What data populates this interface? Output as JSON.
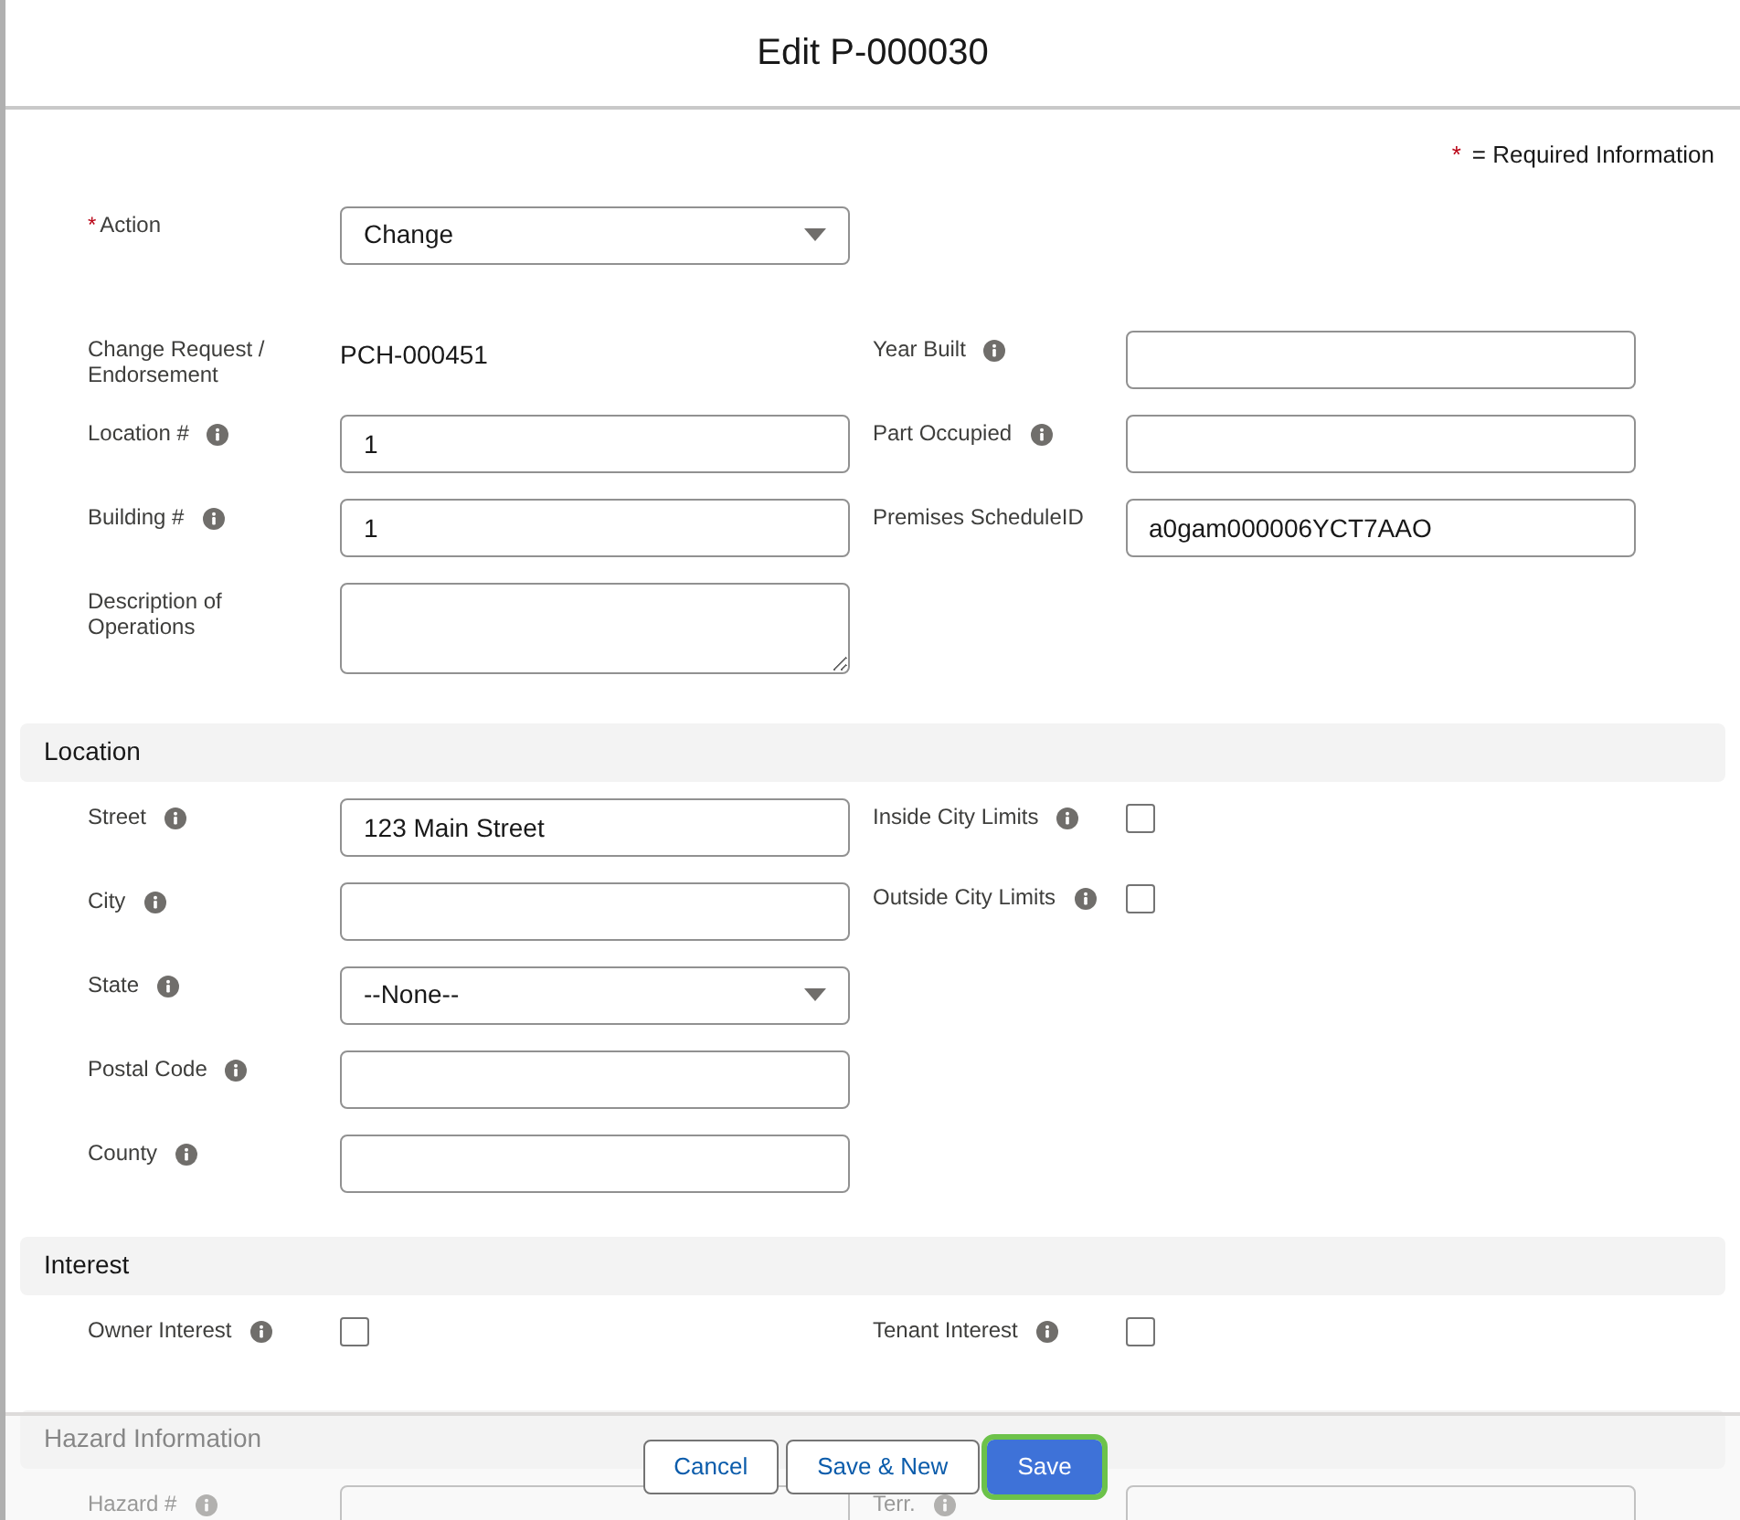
{
  "modal": {
    "title": "Edit P-000030"
  },
  "required_legend": {
    "mark": "*",
    "text": "= Required Information"
  },
  "top_field": {
    "label": "Action",
    "required": true,
    "kind": "select",
    "value": "Change",
    "info": false
  },
  "main_fields": {
    "left": [
      {
        "label": "Change Request / Endorsement",
        "kind": "static",
        "value": "PCH-000451",
        "info": false
      },
      {
        "label": "Location #",
        "kind": "text",
        "value": "1",
        "info": true
      },
      {
        "label": "Building #",
        "kind": "text",
        "value": "1",
        "info": true
      },
      {
        "label": "Description of Operations",
        "kind": "textarea",
        "info": false
      }
    ],
    "right": [
      {
        "label": "Year Built",
        "kind": "text",
        "info": true
      },
      {
        "label": "Part Occupied",
        "kind": "text",
        "info": true
      },
      {
        "label": "Premises ScheduleID",
        "kind": "text",
        "value": "a0gam000006YCT7AAO",
        "info": false
      }
    ]
  },
  "sections": [
    {
      "title": "Location",
      "left": [
        {
          "label": "Street",
          "kind": "text",
          "value": "123 Main Street",
          "info": true
        },
        {
          "label": "City",
          "kind": "text",
          "info": true
        },
        {
          "label": "State",
          "kind": "select",
          "value": "--None--",
          "info": true
        },
        {
          "label": "Postal Code",
          "kind": "text",
          "info": true
        },
        {
          "label": "County",
          "kind": "text",
          "info": true
        }
      ],
      "right": [
        {
          "label": "Inside City Limits",
          "kind": "checkbox",
          "checked": false,
          "info": true
        },
        {
          "label": "Outside City Limits",
          "kind": "checkbox",
          "checked": false,
          "info": true
        }
      ]
    },
    {
      "title": "Interest",
      "left": [
        {
          "label": "Owner Interest",
          "kind": "checkbox",
          "checked": false,
          "info": true
        }
      ],
      "right": [
        {
          "label": "Tenant Interest",
          "kind": "checkbox",
          "checked": false,
          "info": true
        }
      ]
    },
    {
      "title": "Hazard Information",
      "left": [
        {
          "label": "Hazard #",
          "kind": "text",
          "info": true
        }
      ],
      "right": [
        {
          "label": "Terr.",
          "kind": "text",
          "info": true
        }
      ]
    }
  ],
  "footer": {
    "buttons": [
      {
        "label": "Cancel",
        "kind": "neutral"
      },
      {
        "label": "Save & New",
        "kind": "neutral"
      },
      {
        "label": "Save",
        "kind": "brand",
        "focused": true
      }
    ]
  }
}
